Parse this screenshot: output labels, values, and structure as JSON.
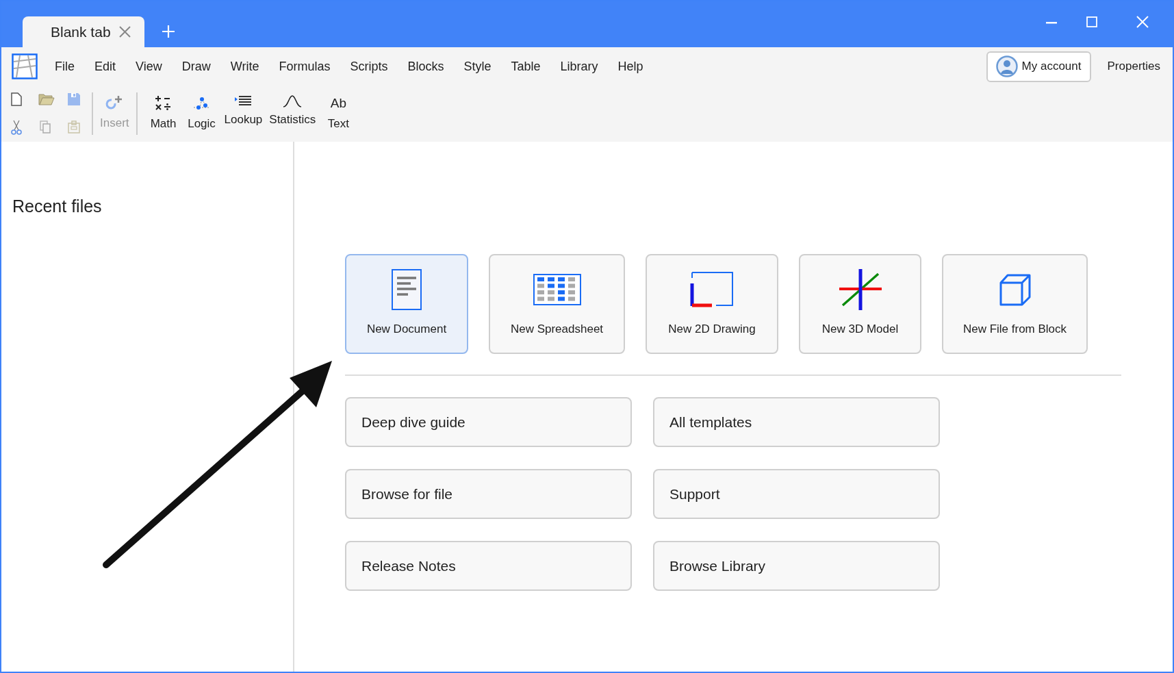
{
  "window": {
    "tab": {
      "label": "Blank tab"
    }
  },
  "menu": [
    "File",
    "Edit",
    "View",
    "Draw",
    "Write",
    "Formulas",
    "Scripts",
    "Blocks",
    "Style",
    "Table",
    "Library",
    "Help"
  ],
  "account_button": "My account",
  "properties_button": "Properties",
  "toolbar": {
    "insert": {
      "label": "Insert",
      "disabled": true
    },
    "tools": [
      {
        "kind": "math",
        "label": "Math"
      },
      {
        "kind": "logic",
        "label": "Logic"
      },
      {
        "kind": "lookup",
        "label": "Lookup"
      },
      {
        "kind": "statistics",
        "label": "Statistics"
      },
      {
        "kind": "text",
        "label": "Text",
        "icon_text": "Ab"
      }
    ]
  },
  "sidebar": {
    "title": "Recent files"
  },
  "new_tiles": [
    {
      "kind": "document",
      "label": "New Document",
      "selected": true
    },
    {
      "kind": "spreadsheet",
      "label": "New Spreadsheet",
      "selected": false
    },
    {
      "kind": "drawing2d",
      "label": "New 2D Drawing",
      "selected": false
    },
    {
      "kind": "model3d",
      "label": "New 3D Model",
      "selected": false
    },
    {
      "kind": "block",
      "label": "New File from Block",
      "selected": false
    }
  ],
  "links": [
    "Deep dive guide",
    "All templates",
    "Browse for file",
    "Support",
    "Release Notes",
    "Browse Library"
  ]
}
